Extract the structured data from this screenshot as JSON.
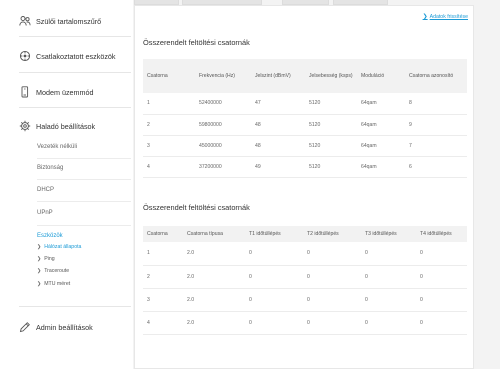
{
  "sidebar": {
    "items": [
      {
        "label": "Szülői tartalomszűrő",
        "icon": "people-icon"
      },
      {
        "label": "Csatlakoztatott eszközök",
        "icon": "devices-icon"
      },
      {
        "label": "Modem üzemmód",
        "icon": "modem-icon"
      },
      {
        "label": "Haladó beállítások",
        "icon": "gear-icon"
      }
    ],
    "sub_items": [
      {
        "label": "Vezeték nélküli"
      },
      {
        "label": "Biztonság"
      },
      {
        "label": "DHCP"
      },
      {
        "label": "UPnP"
      },
      {
        "label": "Eszközök"
      }
    ],
    "tools": [
      {
        "label": "Hálózat állapota"
      },
      {
        "label": "Ping"
      },
      {
        "label": "Traceroute"
      },
      {
        "label": "MTU méret"
      }
    ],
    "admin": {
      "label": "Admin beállítások",
      "icon": "pencil-icon"
    }
  },
  "main": {
    "refresh_label": "Adatok frissítése",
    "downstream": {
      "title": "Összerendelt feltöltési csatornák",
      "columns": [
        "Csatorna",
        "Frekvencia (Hz)",
        "Jelszint (dBmV)",
        "Jelsebesség (ksps)",
        "Moduláció",
        "Csatorna azonosító"
      ],
      "rows": [
        [
          "1",
          "52400000",
          "47",
          "5120",
          "64qam",
          "8"
        ],
        [
          "2",
          "59800000",
          "48",
          "5120",
          "64qam",
          "9"
        ],
        [
          "3",
          "45000000",
          "48",
          "5120",
          "64qam",
          "7"
        ],
        [
          "4",
          "37200000",
          "49",
          "5120",
          "64qam",
          "6"
        ]
      ]
    },
    "upstream": {
      "title": "Összerendelt feltöltési csatornák",
      "columns": [
        "Csatorna",
        "Csatorna típusa",
        "T1 időtúllépés",
        "T2 időtúllépés",
        "T3 időtúllépés",
        "T4 időtúllépés"
      ],
      "rows": [
        [
          "1",
          "2.0",
          "0",
          "0",
          "0",
          "0"
        ],
        [
          "2",
          "2.0",
          "0",
          "0",
          "0",
          "0"
        ],
        [
          "3",
          "2.0",
          "0",
          "0",
          "0",
          "0"
        ],
        [
          "4",
          "2.0",
          "0",
          "0",
          "0",
          "0"
        ]
      ]
    }
  },
  "colors": {
    "accent": "#1a9ad6",
    "header_bg": "#f2f2f2",
    "page_bg": "#f3f3f3"
  }
}
